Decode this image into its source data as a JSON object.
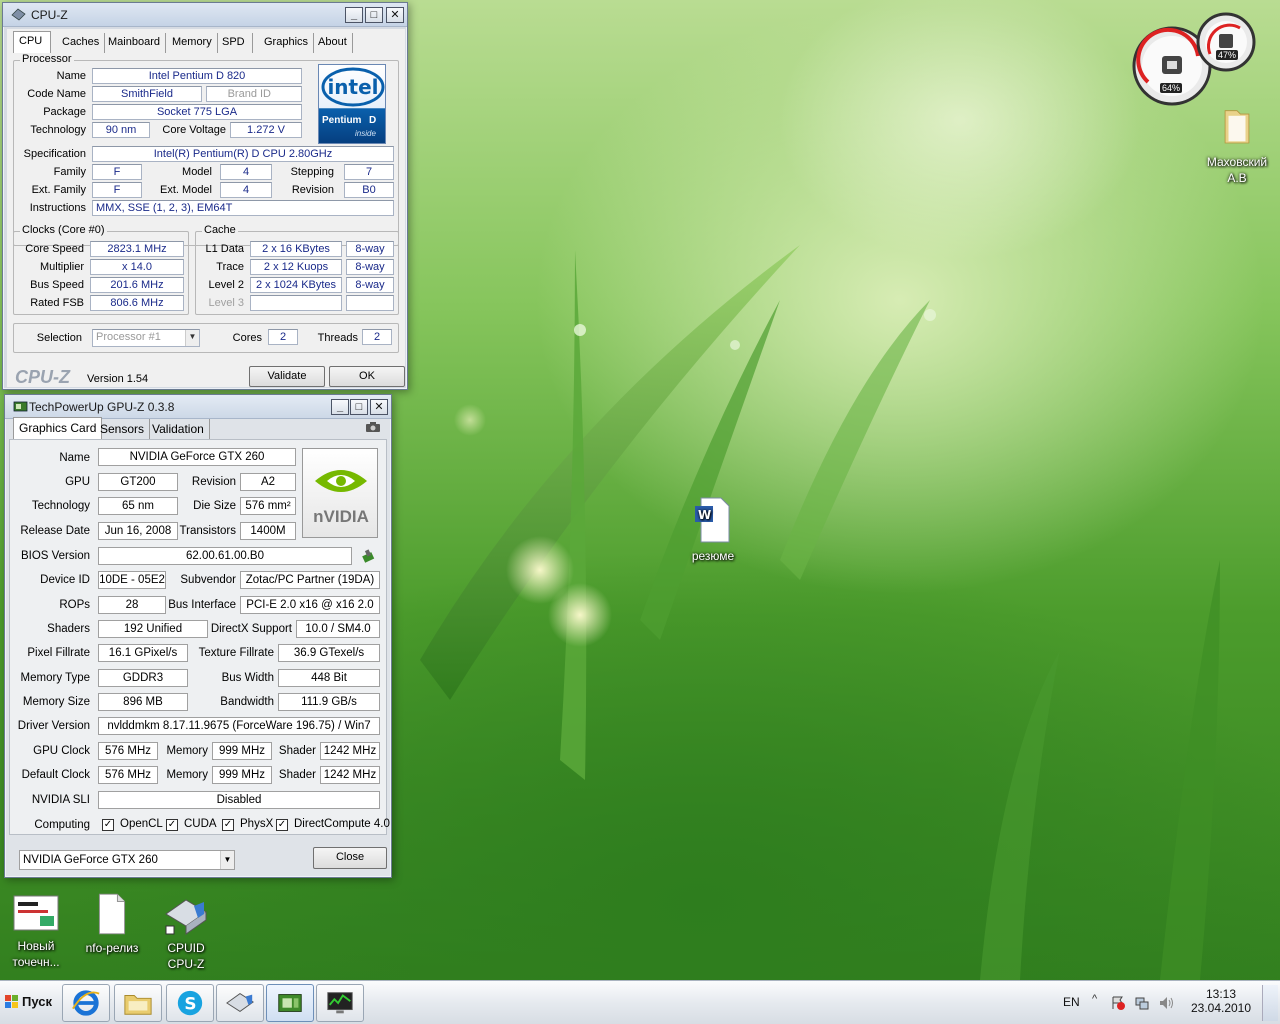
{
  "cpuz": {
    "title": "CPU-Z",
    "tabs": [
      "CPU",
      "Caches",
      "Mainboard",
      "Memory",
      "SPD",
      "Graphics",
      "About"
    ],
    "processor_group": "Processor",
    "name_label": "Name",
    "name": "Intel Pentium D 820",
    "codename_label": "Code Name",
    "codename": "SmithField",
    "brandid_label": "Brand ID",
    "package_label": "Package",
    "package": "Socket 775 LGA",
    "technology_label": "Technology",
    "technology": "90 nm",
    "corevoltage_label": "Core Voltage",
    "corevoltage": "1.272 V",
    "specification_label": "Specification",
    "specification": "Intel(R) Pentium(R) D CPU 2.80GHz",
    "family_label": "Family",
    "family": "F",
    "model_label": "Model",
    "model": "4",
    "stepping_label": "Stepping",
    "stepping": "7",
    "extfamily_label": "Ext. Family",
    "extfamily": "F",
    "extmodel_label": "Ext. Model",
    "extmodel": "4",
    "revision_label": "Revision",
    "revision": "B0",
    "instructions_label": "Instructions",
    "instructions": "MMX, SSE (1, 2, 3), EM64T",
    "logo": {
      "brand": "intel",
      "line1": "Pentium",
      "line2": "D",
      "line3": "inside"
    },
    "clocks_group": "Clocks (Core #0)",
    "corespeed_label": "Core Speed",
    "corespeed": "2823.1 MHz",
    "multiplier_label": "Multiplier",
    "multiplier": "x 14.0",
    "busspeed_label": "Bus Speed",
    "busspeed": "201.6 MHz",
    "ratedfsb_label": "Rated FSB",
    "ratedfsb": "806.6 MHz",
    "cache_group": "Cache",
    "l1_label": "L1 Data",
    "l1": "2 x 16 KBytes",
    "l1_way": "8-way",
    "trace_label": "Trace",
    "trace": "2 x 12 Kuops",
    "trace_way": "8-way",
    "l2_label": "Level 2",
    "l2": "2 x 1024 KBytes",
    "l2_way": "8-way",
    "l3_label": "Level 3",
    "selection_label": "Selection",
    "selection": "Processor #1",
    "cores_label": "Cores",
    "cores": "2",
    "threads_label": "Threads",
    "threads": "2",
    "brand": "CPU-Z",
    "version": "Version 1.54",
    "validate": "Validate",
    "ok": "OK"
  },
  "gpuz": {
    "title": "TechPowerUp GPU-Z 0.3.8",
    "tabs": [
      "Graphics Card",
      "Sensors",
      "Validation"
    ],
    "name_label": "Name",
    "name": "NVIDIA GeForce GTX 260",
    "gpu_label": "GPU",
    "gpu": "GT200",
    "revision_label": "Revision",
    "revision": "A2",
    "technology_label": "Technology",
    "technology": "65 nm",
    "diesize_label": "Die Size",
    "diesize": "576 mm²",
    "release_label": "Release Date",
    "release": "Jun 16, 2008",
    "transistors_label": "Transistors",
    "transistors": "1400M",
    "bios_label": "BIOS Version",
    "bios": "62.00.61.00.B0",
    "deviceid_label": "Device ID",
    "deviceid": "10DE - 05E2",
    "subvendor_label": "Subvendor",
    "subvendor": "Zotac/PC Partner (19DA)",
    "rops_label": "ROPs",
    "rops": "28",
    "businterface_label": "Bus Interface",
    "businterface": "PCI-E 2.0 x16 @ x16 2.0",
    "shaders_label": "Shaders",
    "shaders": "192 Unified",
    "directx_label": "DirectX Support",
    "directx": "10.0 / SM4.0",
    "pixelfill_label": "Pixel Fillrate",
    "pixelfill": "16.1 GPixel/s",
    "texturefill_label": "Texture Fillrate",
    "texturefill": "36.9 GTexel/s",
    "memtype_label": "Memory Type",
    "memtype": "GDDR3",
    "buswidth_label": "Bus Width",
    "buswidth": "448 Bit",
    "memsize_label": "Memory Size",
    "memsize": "896 MB",
    "bandwidth_label": "Bandwidth",
    "bandwidth": "111.9 GB/s",
    "driver_label": "Driver Version",
    "driver": "nvlddmkm 8.17.11.9675 (ForceWare 196.75) / Win7",
    "gpuclock_label": "GPU Clock",
    "gpuclock": "576 MHz",
    "memory_label": "Memory",
    "memclock": "999 MHz",
    "shader_label": "Shader",
    "shaderclock": "1242 MHz",
    "defclock_label": "Default Clock",
    "defclock": "576 MHz",
    "defmem": "999 MHz",
    "defshader": "1242 MHz",
    "sli_label": "NVIDIA SLI",
    "sli": "Disabled",
    "computing_label": "Computing",
    "opencl": "OpenCL",
    "cuda": "CUDA",
    "physx": "PhysX",
    "directcompute": "DirectCompute 4.0",
    "selected_card": "NVIDIA GeForce GTX 260",
    "close": "Close",
    "logo": "nVIDIA"
  },
  "gadget": {
    "cpu_percent": "64%",
    "mem_percent": "47%"
  },
  "desktop": {
    "icons": [
      {
        "label_line1": "Маховский",
        "label_line2": "А.В"
      },
      {
        "label_line1": "резюме",
        "label_line2": ""
      },
      {
        "label_line1": "Новый",
        "label_line2": "точечн..."
      },
      {
        "label_line1": "nfo-релиз",
        "label_line2": ""
      },
      {
        "label_line1": "CPUID",
        "label_line2": "CPU-Z"
      }
    ]
  },
  "taskbar": {
    "start_label": "Пуск",
    "language": "EN",
    "time": "13:13",
    "date": "23.04.2010"
  },
  "colors": {
    "value_text": "#1a2a8a",
    "intel_blue": "#0860a8",
    "nvidia_green": "#76b900"
  }
}
